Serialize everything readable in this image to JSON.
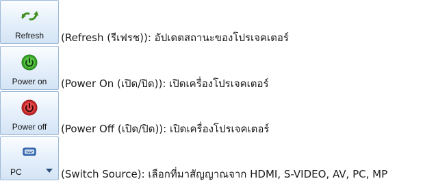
{
  "items": [
    {
      "button_label": "Refresh",
      "icon": "refresh-arrows-icon",
      "description": "(Refresh (รีเฟรช)): อัปเดตสถานะของโปรเจคเตอร์"
    },
    {
      "button_label": "Power on",
      "icon": "power-on-icon",
      "description": "(Power On (เปิด/ปิด)): เปิดเครื่องโปรเจคเตอร์"
    },
    {
      "button_label": "Power off",
      "icon": "power-off-icon",
      "description": "(Power Off (เปิด/ปิด)): เปิดเครื่องโปรเจคเตอร์"
    },
    {
      "button_label": "PC",
      "icon": "vga-port-icon",
      "dropdown_icon": "chevron-down-icon",
      "description": "(Switch Source): เลือกที่มาสัญญาณจาก HDMI, S-VIDEO, AV, PC, MP"
    }
  ],
  "colors": {
    "button_border": "#9eb9d6",
    "button_bg_top": "#fbfdff",
    "button_bg_bottom": "#d4e4f5",
    "refresh_green": "#3f8f1f",
    "power_on_green": "#3aa32a",
    "power_off_red": "#c8282a",
    "vga_blue": "#3a6fb8"
  }
}
